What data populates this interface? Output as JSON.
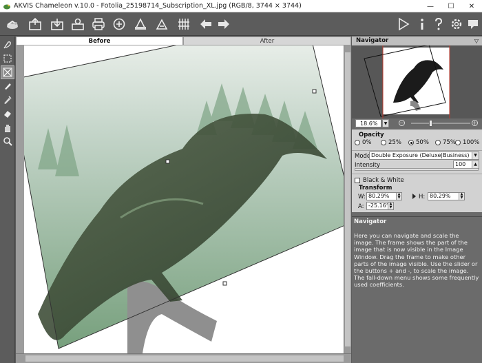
{
  "window": {
    "title": "AKVIS Chameleon v.10.0 - Fotolia_25198714_Subscription_XL.jpg (RGB/8, 3744 × 3744)",
    "minimize": "—",
    "maximize": "☐",
    "close": "✕"
  },
  "toolbar": {
    "buttons": [
      "home-icon",
      "open-icon",
      "save-icon",
      "share-icon",
      "print-icon",
      "plugin-icon",
      "batch-icon",
      "export-icon",
      "settings-grid-icon",
      "undo-icon",
      "redo-icon",
      "run-icon",
      "info-icon",
      "help-icon",
      "preferences-icon",
      "feedback-icon"
    ]
  },
  "tools": [
    "selection-icon",
    "rect-select-icon",
    "transform-icon",
    "brush-icon",
    "refine-icon",
    "eraser-icon",
    "hand-icon",
    "zoom-icon"
  ],
  "tabs": {
    "before": "Before",
    "after": "After"
  },
  "navigator": {
    "title": "Navigator",
    "menu_arrow": "▽",
    "zoom_value": "18.6%",
    "zoom_drop": "▼",
    "zoom_minus": "−",
    "zoom_plus": "+",
    "zoom_level": 0.33
  },
  "settings": {
    "opacity_label": "Opacity",
    "opacity_options": [
      "0%",
      "25%",
      "50%",
      "75%",
      "100%"
    ],
    "opacity_selected": "50%",
    "mode_label": "Mode",
    "mode_value": "Double Exposure (Deluxe|Business)",
    "intensity_label": "Intensity",
    "intensity_value": "100",
    "bw_label": "Black & White",
    "transform_label": "Transform",
    "w_label": "W:",
    "w_value": "80.29%",
    "h_label": "H:",
    "h_value": "80.29%",
    "a_label": "A:",
    "a_value": "-25.16°"
  },
  "help": {
    "title": "Navigator",
    "text": "Here you can navigate and scale the image. The frame shows the part of the image that is now visible in the Image Window. Drag the frame to make other parts of the image visible. Use the slider or the buttons + and -, to scale the image. The fall-down menu shows some frequently used coefficients."
  },
  "colors": {
    "toolbar_bg": "#5c5c5c",
    "panel_bg": "#d2d2d2",
    "help_bg": "#6b6b6b"
  }
}
